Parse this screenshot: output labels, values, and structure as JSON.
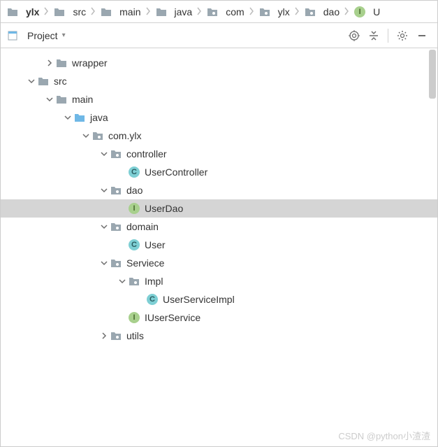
{
  "breadcrumb": [
    {
      "label": "ylx",
      "bold": true,
      "type": "folder"
    },
    {
      "label": "src",
      "type": "folder"
    },
    {
      "label": "main",
      "type": "folder"
    },
    {
      "label": "java",
      "type": "folder"
    },
    {
      "label": "com",
      "type": "pkg"
    },
    {
      "label": "ylx",
      "type": "pkg"
    },
    {
      "label": "dao",
      "type": "pkg"
    },
    {
      "label": "U",
      "type": "interface"
    }
  ],
  "toolbar": {
    "label": "Project"
  },
  "tree": [
    {
      "indent": 2,
      "arrow": "right",
      "icon": "folder-gray",
      "label": "wrapper"
    },
    {
      "indent": 1,
      "arrow": "down",
      "icon": "folder-gray",
      "label": "src"
    },
    {
      "indent": 2,
      "arrow": "down",
      "icon": "folder-gray",
      "label": "main"
    },
    {
      "indent": 3,
      "arrow": "down",
      "icon": "folder-blue",
      "label": "java"
    },
    {
      "indent": 4,
      "arrow": "down",
      "icon": "pkg",
      "label": "com.ylx"
    },
    {
      "indent": 5,
      "arrow": "down",
      "icon": "pkg",
      "label": "controller"
    },
    {
      "indent": 6,
      "arrow": "",
      "icon": "class-c",
      "label": "UserController"
    },
    {
      "indent": 5,
      "arrow": "down",
      "icon": "pkg",
      "label": "dao"
    },
    {
      "indent": 6,
      "arrow": "",
      "icon": "class-i",
      "label": "UserDao",
      "selected": true
    },
    {
      "indent": 5,
      "arrow": "down",
      "icon": "pkg",
      "label": "domain"
    },
    {
      "indent": 6,
      "arrow": "",
      "icon": "class-c",
      "label": "User"
    },
    {
      "indent": 5,
      "arrow": "down",
      "icon": "pkg",
      "label": "Serviece"
    },
    {
      "indent": 6,
      "arrow": "down",
      "icon": "pkg",
      "label": "Impl"
    },
    {
      "indent": 7,
      "arrow": "",
      "icon": "class-c",
      "label": "UserServiceImpl"
    },
    {
      "indent": 6,
      "arrow": "",
      "icon": "class-i",
      "label": "IUserService"
    },
    {
      "indent": 5,
      "arrow": "right",
      "icon": "pkg",
      "label": "utils"
    }
  ],
  "watermark": "CSDN @python小渣渣"
}
